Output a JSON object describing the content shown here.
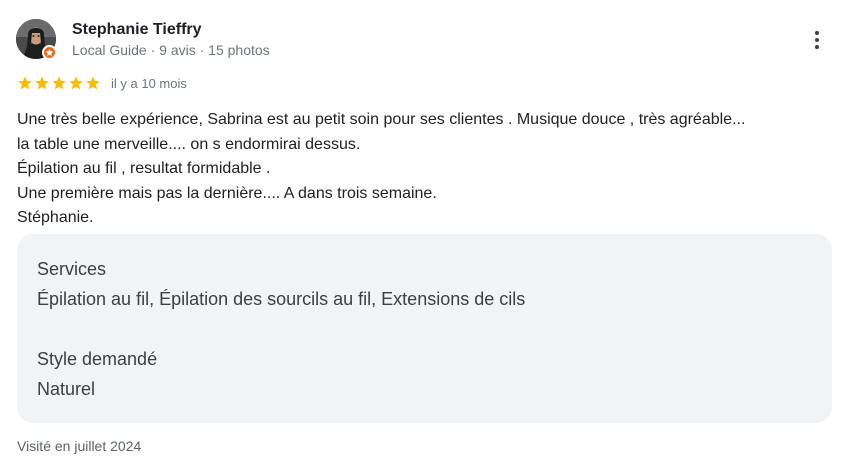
{
  "author": {
    "name": "Stephanie Tieffry",
    "meta": "Local Guide · 9 avis · 15 photos",
    "avatar_icon": "user-photo-icon",
    "badge_icon": "local-guide-star-icon",
    "badge_color": "#ea6b1f"
  },
  "rating": {
    "stars": 5,
    "max_stars": 5,
    "star_color": "#fbbc04",
    "date": "il y a 10 mois"
  },
  "review": {
    "lines": [
      "Une très belle expérience, Sabrina est au petit soin pour ses clientes . Musique douce , très agréable...",
      "la table une merveille.... on s endormirai dessus.",
      "Épilation au fil , resultat formidable .",
      "Une première mais pas la dernière.... A dans trois semaine.",
      "Stéphanie."
    ]
  },
  "details": [
    {
      "label": "Services",
      "value": "Épilation au fil, Épilation des sourcils au fil, Extensions de cils"
    },
    {
      "label": "Style demandé",
      "value": "Naturel"
    }
  ],
  "visited": "Visité en juillet 2024",
  "menu": {
    "icon": "more-vertical-icon"
  },
  "colors": {
    "card_background": "#f1f3f4",
    "secondary_text": "#70757a"
  }
}
